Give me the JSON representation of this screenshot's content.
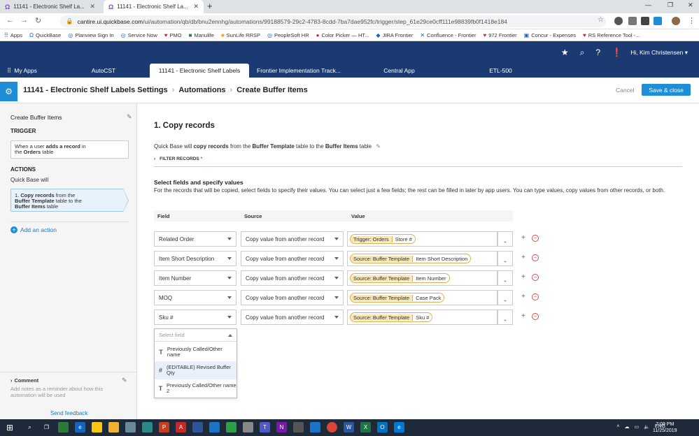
{
  "browser": {
    "tabs": [
      {
        "title": "11141 - Electronic Shelf La...",
        "active": false
      },
      {
        "title": "11141 - Electronic Shelf La...",
        "active": true
      }
    ],
    "address": {
      "host": "cantire.ui.quickbase.com",
      "path": "/ui/automation/qb/db/bnu2ennhg/automations/99188579-29c2-4783-8cdd-7ba7dae952fc/trigger/step_61e29ce0cff111e98839fb0f1418e184"
    },
    "bookmarks": [
      "Apps",
      "QuickBase",
      "Planview Sign In",
      "Service Now",
      "PMO",
      "Manulife",
      "SunLife RRSP",
      "PeopleSoft HR",
      "Color Picker — HT...",
      "JIRA Frontier",
      "Confluence - Frontier",
      "972 Frontier",
      "Concur - Expenses",
      "RS Reference Tool -..."
    ]
  },
  "header": {
    "user": "Hi, Kim Christensen"
  },
  "app_tabs": [
    "My Apps",
    "AutoCST",
    "11141 - Electronic Shelf Labels",
    "Frontier Implementation Track...",
    "Central App",
    "ETL-500"
  ],
  "page": {
    "breadcrumb": [
      "11141 - Electronic Shelf Labels Settings",
      "Automations",
      "Create Buffer Items"
    ],
    "cancel_label": "Cancel",
    "save_label": "Save & close"
  },
  "sidebar": {
    "title": "Create Buffer Items",
    "trigger_heading": "TRIGGER",
    "trigger_pre": "When a user ",
    "trigger_bold1": "adds a record",
    "trigger_mid": " in",
    "trigger_pre2": "the ",
    "trigger_bold2": "Orders",
    "trigger_post": " table",
    "actions_heading": "ACTIONS",
    "actions_intro": "Quick Base will",
    "action_num": "1. ",
    "action_bold1": "Copy records",
    "action_t1": " from the",
    "action_bold2": "Buffer Template",
    "action_t2": " table to the",
    "action_bold3": "Buffer Items",
    "action_t3": " table",
    "add_action": "Add an action",
    "comment_heading": "Comment",
    "comment_hint": "Add notes as a reminder about how this automation will be used",
    "send_feedback": "Send feedback"
  },
  "main": {
    "title": "1. Copy records",
    "desc_pre": "Quick Base will ",
    "desc_b1": "copy records",
    "desc_t1": " from the ",
    "desc_b2": "Buffer Template",
    "desc_t2": " table to the ",
    "desc_b3": "Buffer Items",
    "desc_t3": " table",
    "filter_label": "FILTER RECORDS",
    "filter_star": "*",
    "fields_title": "Select fields and specify values",
    "fields_desc": "For the records that will be copied, select fields to specify their values. You can select just a few fields; the rest can be filled in later by app users. You can type values, copy values from other records, or both.",
    "col_field": "Field",
    "col_source": "Source",
    "col_value": "Value",
    "rows": [
      {
        "field": "Related Order",
        "source": "Copy value from another record",
        "chip1": "Trigger: Orders",
        "chip2": "Store #"
      },
      {
        "field": "Item Short Description",
        "source": "Copy value from another record",
        "chip1": "Source: Buffer Template",
        "chip2": "Item Short Description"
      },
      {
        "field": "Item Number",
        "source": "Copy value from another record",
        "chip1": "Source: Buffer Template",
        "chip2": "Item Number"
      },
      {
        "field": "MOQ",
        "source": "Copy value from another record",
        "chip1": "Source: Buffer Template",
        "chip2": "Case Pack"
      },
      {
        "field": "Sku #",
        "source": "Copy value from another record",
        "chip1": "Source: Buffer Template",
        "chip2": "Sku #"
      }
    ],
    "dropdown": {
      "placeholder": "Select field",
      "options": [
        {
          "icon": "T",
          "label": "Previously Called/Other name"
        },
        {
          "icon": "#",
          "label": "(EDITABLE) Revised Buffer Qty"
        },
        {
          "icon": "T",
          "label": "Previously Called/Other name 2"
        }
      ]
    }
  },
  "taskbar": {
    "lang": "ENG",
    "time": "7:09 PM",
    "date": "11/25/2019"
  }
}
